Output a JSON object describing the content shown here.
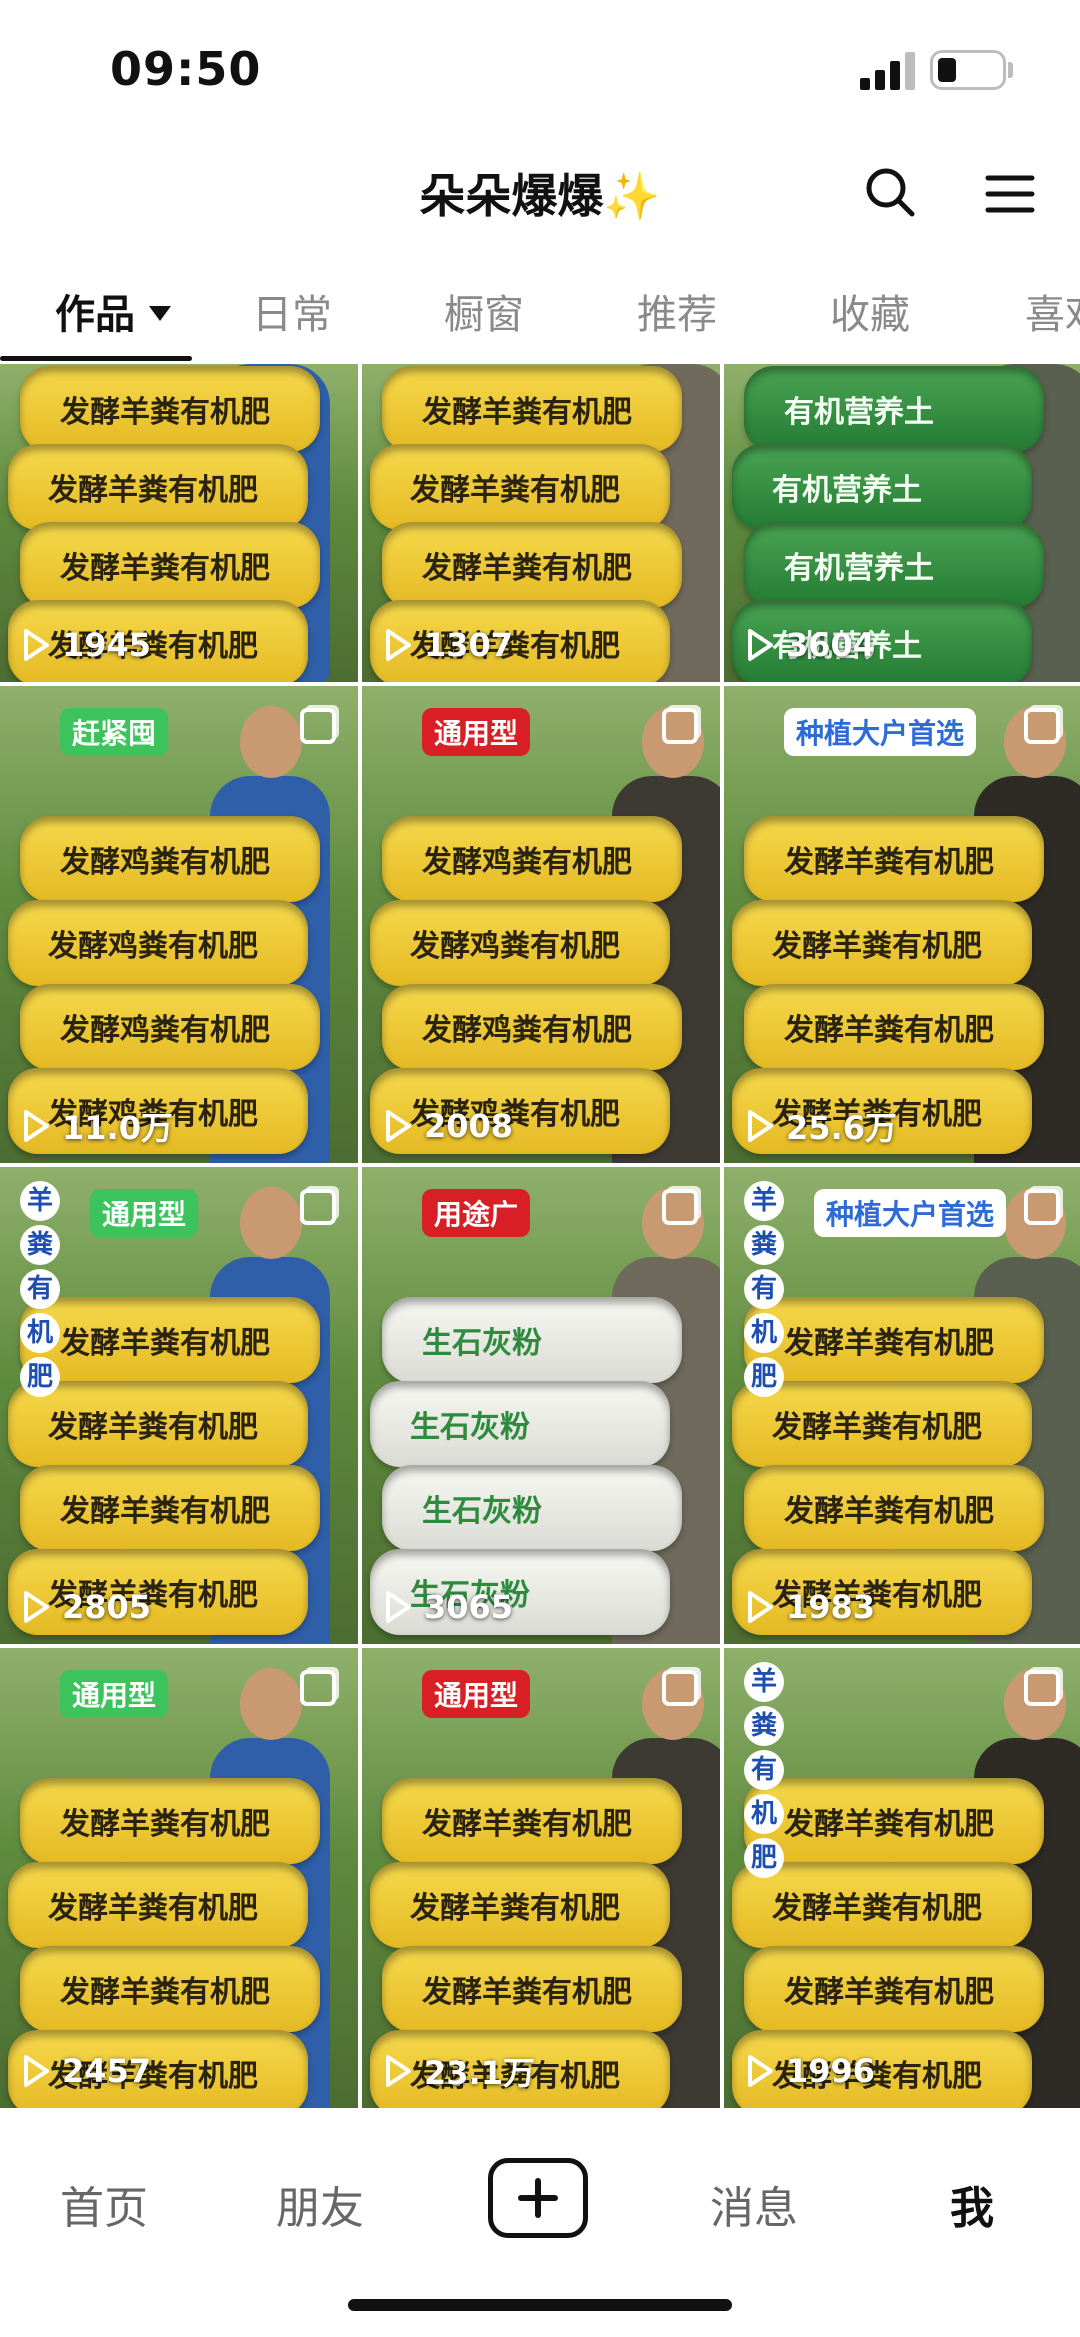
{
  "status_bar": {
    "time": "09:50"
  },
  "header": {
    "title": "朵朵爆爆✨"
  },
  "tabs": [
    {
      "label": "作品"
    },
    {
      "label": "日常"
    },
    {
      "label": "橱窗"
    },
    {
      "label": "推荐"
    },
    {
      "label": "收藏"
    },
    {
      "label": "喜欢"
    }
  ],
  "grid": {
    "items": [
      {
        "views": "1945",
        "bag_text": "发酵羊粪有机肥",
        "bag_color": "#f2cf3a",
        "multi": false
      },
      {
        "views": "1307",
        "bag_text": "发酵羊粪有机肥",
        "bag_color": "#f2cf3a",
        "multi": false
      },
      {
        "views": "3604",
        "bag_text": "有机营养土",
        "bag_color": "#2f8f3e",
        "multi": false
      },
      {
        "views": "11.0万",
        "bag_text": "发酵鸡粪有机肥",
        "bag_color": "#f2cf3a",
        "multi": true,
        "sticker": "赶紧囤"
      },
      {
        "views": "2008",
        "bag_text": "发酵鸡粪有机肥",
        "bag_color": "#f2cf3a",
        "multi": true,
        "sticker": "通用型"
      },
      {
        "views": "25.6万",
        "bag_text": "发酵羊粪有机肥",
        "bag_color": "#f2cf3a",
        "multi": true,
        "sticker": "种植大户首选"
      },
      {
        "views": "2805",
        "bag_text": "发酵羊粪有机肥",
        "bag_color": "#f2cf3a",
        "multi": true,
        "sticker": "通用型",
        "vertical": [
          "羊",
          "粪",
          "有",
          "机",
          "肥"
        ]
      },
      {
        "views": "3065",
        "bag_text": "生石灰粉",
        "bag_color": "#f3f3ee",
        "multi": true,
        "sticker": "用途广"
      },
      {
        "views": "1983",
        "bag_text": "发酵羊粪有机肥",
        "bag_color": "#f2cf3a",
        "multi": true,
        "sticker": "种植大户首选",
        "vertical": [
          "羊",
          "粪",
          "有",
          "机",
          "肥"
        ]
      },
      {
        "views": "2457",
        "bag_text": "发酵羊粪有机肥",
        "bag_color": "#f2cf3a",
        "multi": true,
        "sticker": "通用型"
      },
      {
        "views": "23.1万",
        "bag_text": "发酵羊粪有机肥",
        "bag_color": "#f2cf3a",
        "multi": true,
        "sticker": "通用型"
      },
      {
        "views": "1996",
        "bag_text": "发酵羊粪有机肥",
        "bag_color": "#f2cf3a",
        "multi": true,
        "vertical": [
          "羊",
          "粪",
          "有",
          "机",
          "肥"
        ]
      }
    ]
  },
  "bottom_nav": {
    "home": "首页",
    "friends": "朋友",
    "messages": "消息",
    "me": "我"
  },
  "icons": {
    "search": "search-icon",
    "menu": "hamburger-menu-icon",
    "add": "plus-icon",
    "play": "play-icon",
    "multi": "multi-image-icon"
  }
}
